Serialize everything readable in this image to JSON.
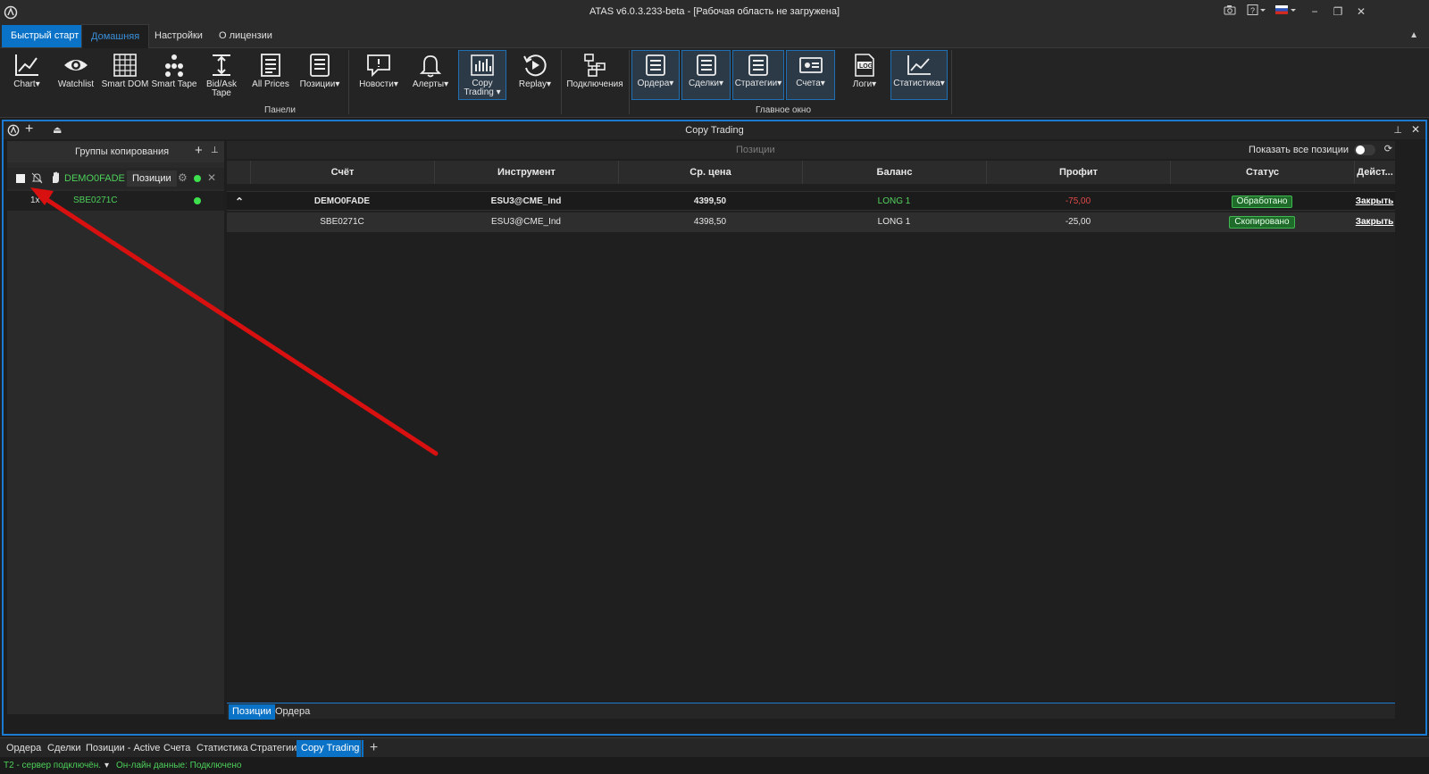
{
  "window": {
    "title": "ATAS v6.0.3.233-beta - [Рабочая область не загружена]"
  },
  "ribbon_tabs": [
    "Быстрый старт",
    "Домашняя",
    "Настройки",
    "О лицензии"
  ],
  "ribbon": {
    "panels_group_label": "Панели",
    "main_window_group_label": "Главное окно",
    "buttons": {
      "chart": "Chart",
      "watchlist": "Watchlist",
      "smart_dom": "Smart DOM",
      "smart_tape": "Smart Tape",
      "bid_ask_tape": "Bid/Ask Tape",
      "all_prices": "All Prices",
      "positions": "Позиции",
      "news": "Новости",
      "alerts": "Алерты",
      "copy_trading": "Copy Trading",
      "replay": "Replay",
      "connections": "Подключения",
      "orders": "Ордера",
      "trades": "Сделки",
      "strategies": "Стратегии",
      "accounts": "Счета",
      "logs": "Логи",
      "statistics": "Статистика"
    }
  },
  "panel": {
    "title": "Copy Trading"
  },
  "left_panel": {
    "header": "Группы копирования",
    "group": {
      "account": "DEMO0FADE",
      "positions_button": "Позиции"
    },
    "child": {
      "multiplier": "1x",
      "account": "SBE0271C"
    }
  },
  "right_panel": {
    "header": "Позиции",
    "show_all_label": "Показать все позиции",
    "columns": [
      "Счёт",
      "Инструмент",
      "Ср. цена",
      "Баланс",
      "Профит",
      "Статус",
      "Дейст..."
    ],
    "rows": [
      {
        "account": "DEMO0FADE",
        "instrument": "ESU3@CME_Ind",
        "avg_price": "4399,50",
        "balance": "LONG  1",
        "profit": "-75,00",
        "status": "Обработано",
        "action": "Закрыть"
      },
      {
        "account": "SBE0271C",
        "instrument": "ESU3@CME_Ind",
        "avg_price": "4398,50",
        "balance": "LONG  1",
        "profit": "-25,00",
        "status": "Скопировано",
        "action": "Закрыть"
      }
    ],
    "bottom_tabs": [
      "Позиции",
      "Ордера"
    ]
  },
  "workspace_tabs": [
    "Ордера",
    "Сделки",
    "Позиции - Active",
    "Счета",
    "Статистика",
    "Стратегии",
    "Copy Trading"
  ],
  "status_bar": {
    "server": "T2 - сервер подключён.",
    "online": "Он-лайн данные: Подключено"
  },
  "colors": {
    "accent": "#0a72c7",
    "active_green": "#3ee04e",
    "loss_red": "#e24848",
    "annotation_arrow": "#d81010"
  }
}
